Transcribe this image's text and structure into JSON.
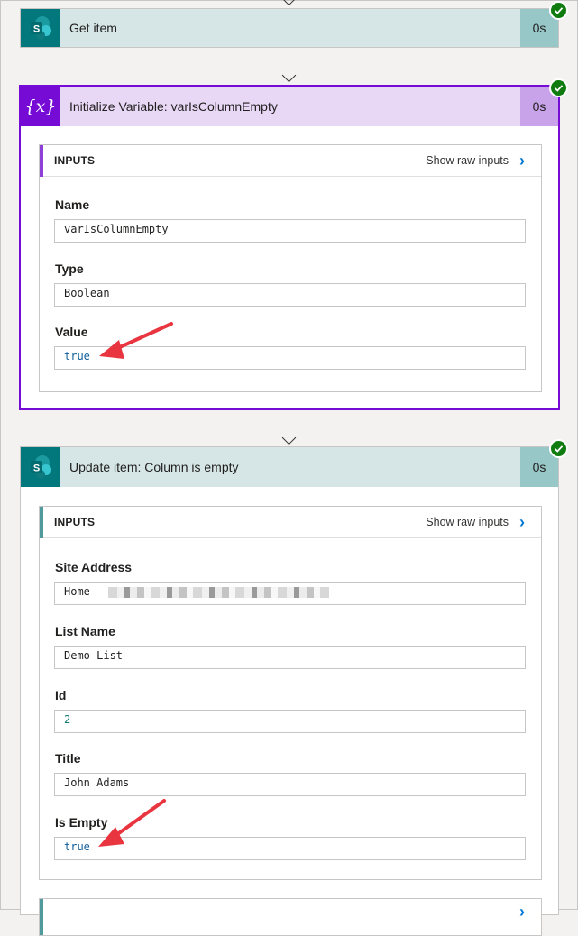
{
  "steps": [
    {
      "title": "Get item",
      "duration": "0s",
      "icon": "sharepoint-icon",
      "colors": {
        "header": "#d6e6e6",
        "icon_bg": "#03787c",
        "duration_bg": "#98c7c7"
      }
    },
    {
      "title": "Initialize Variable: varIsColumnEmpty",
      "duration": "0s",
      "icon": "variable-icon",
      "colors": {
        "header": "#e8d8f6",
        "icon_bg": "#770bd6",
        "duration_bg": "#c9a3ea",
        "border": "#770bd6"
      },
      "inputs": {
        "header_label": "INPUTS",
        "raw_link": "Show raw inputs",
        "fields": [
          {
            "label": "Name",
            "value": "varIsColumnEmpty"
          },
          {
            "label": "Type",
            "value": "Boolean"
          },
          {
            "label": "Value",
            "value": "true"
          }
        ]
      }
    },
    {
      "title": "Update item: Column is empty",
      "duration": "0s",
      "icon": "sharepoint-icon",
      "colors": {
        "header": "#d6e6e6",
        "icon_bg": "#03787c",
        "duration_bg": "#98c7c7",
        "inputs_bar": "#4f9a9c"
      },
      "inputs": {
        "header_label": "INPUTS",
        "raw_link": "Show raw inputs",
        "fields": [
          {
            "label": "Site Address",
            "value": "Home -"
          },
          {
            "label": "List Name",
            "value": "Demo List"
          },
          {
            "label": "Id",
            "value": "2"
          },
          {
            "label": "Title",
            "value": "John Adams"
          },
          {
            "label": "Is Empty",
            "value": "true"
          }
        ]
      }
    }
  ],
  "status": {
    "success_color": "#107c10",
    "annotation_color": "#e8353f"
  }
}
